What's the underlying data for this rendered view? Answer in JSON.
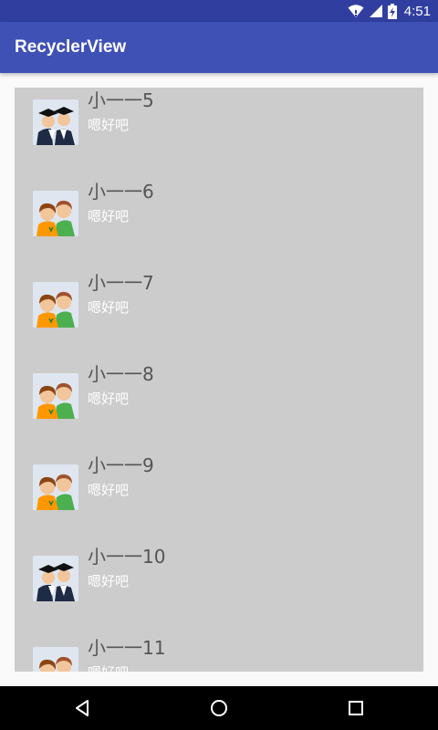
{
  "status_bar": {
    "time": "4:51",
    "icons": [
      "wifi-icon",
      "signal-icon",
      "battery-charging-icon"
    ],
    "color": "#303f9f"
  },
  "app_bar": {
    "title": "RecyclerView",
    "color": "#3f51b5"
  },
  "list": {
    "background": "#cccccc",
    "items": [
      {
        "name": "小一一5",
        "message": "嗯好吧",
        "avatar": "graduates-avatar-icon"
      },
      {
        "name": "小一一6",
        "message": "嗯好吧",
        "avatar": "friends-avatar-icon"
      },
      {
        "name": "小一一7",
        "message": "嗯好吧",
        "avatar": "friends-avatar-icon"
      },
      {
        "name": "小一一8",
        "message": "嗯好吧",
        "avatar": "friends-avatar-icon"
      },
      {
        "name": "小一一9",
        "message": "嗯好吧",
        "avatar": "friends-avatar-icon"
      },
      {
        "name": "小一一10",
        "message": "嗯好吧",
        "avatar": "graduates-avatar-icon"
      },
      {
        "name": "小一一11",
        "message": "嗯好吧",
        "avatar": "friends-avatar-icon"
      }
    ]
  },
  "nav_bar": {
    "buttons": [
      "back-icon",
      "home-icon",
      "recents-icon"
    ]
  }
}
